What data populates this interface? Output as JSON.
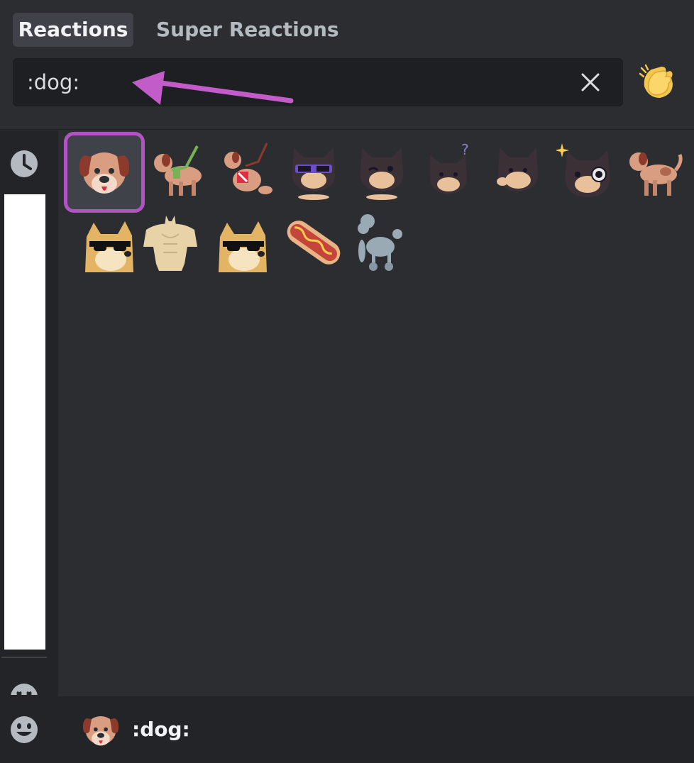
{
  "tabs": [
    {
      "label": "Reactions",
      "active": true
    },
    {
      "label": "Super Reactions",
      "active": false
    }
  ],
  "search": {
    "value": ":dog:",
    "placeholder": ""
  },
  "annotation": {
    "arrow_color": "#c25cc9"
  },
  "skin_tone": {
    "icon": "clapping-hands-icon"
  },
  "rail": {
    "icons": [
      "recent-clock-icon",
      "faces-icon",
      "smiley-icon"
    ]
  },
  "results": [
    {
      "id": "dog-face",
      "icon": "dog-face-icon",
      "selected": true
    },
    {
      "id": "guide-dog",
      "icon": "guide-dog-icon"
    },
    {
      "id": "service-dog",
      "icon": "service-dog-icon"
    },
    {
      "id": "cat-sunglasses",
      "icon": "cat-sunglasses-icon"
    },
    {
      "id": "cat-wink",
      "icon": "cat-wink-icon"
    },
    {
      "id": "cat-question",
      "icon": "cat-question-icon"
    },
    {
      "id": "cat-salute",
      "icon": "cat-salute-icon"
    },
    {
      "id": "cat-sparkle",
      "icon": "cat-sparkle-icon"
    },
    {
      "id": "dog",
      "icon": "dog-icon"
    },
    {
      "id": "doge-sunglasses",
      "icon": "doge-sunglasses-icon"
    },
    {
      "id": "buff-doge",
      "icon": "buff-doge-icon"
    },
    {
      "id": "doge-sunglasses-2",
      "icon": "doge-sunglasses-icon"
    },
    {
      "id": "hot-dog",
      "icon": "hot-dog-icon"
    },
    {
      "id": "poodle",
      "icon": "poodle-icon"
    }
  ],
  "preview": {
    "name": ":dog:",
    "icon": "dog-face-icon"
  },
  "colors": {
    "selected_border": "#b153c2",
    "background": "#2b2d31",
    "rail": "#232428"
  }
}
